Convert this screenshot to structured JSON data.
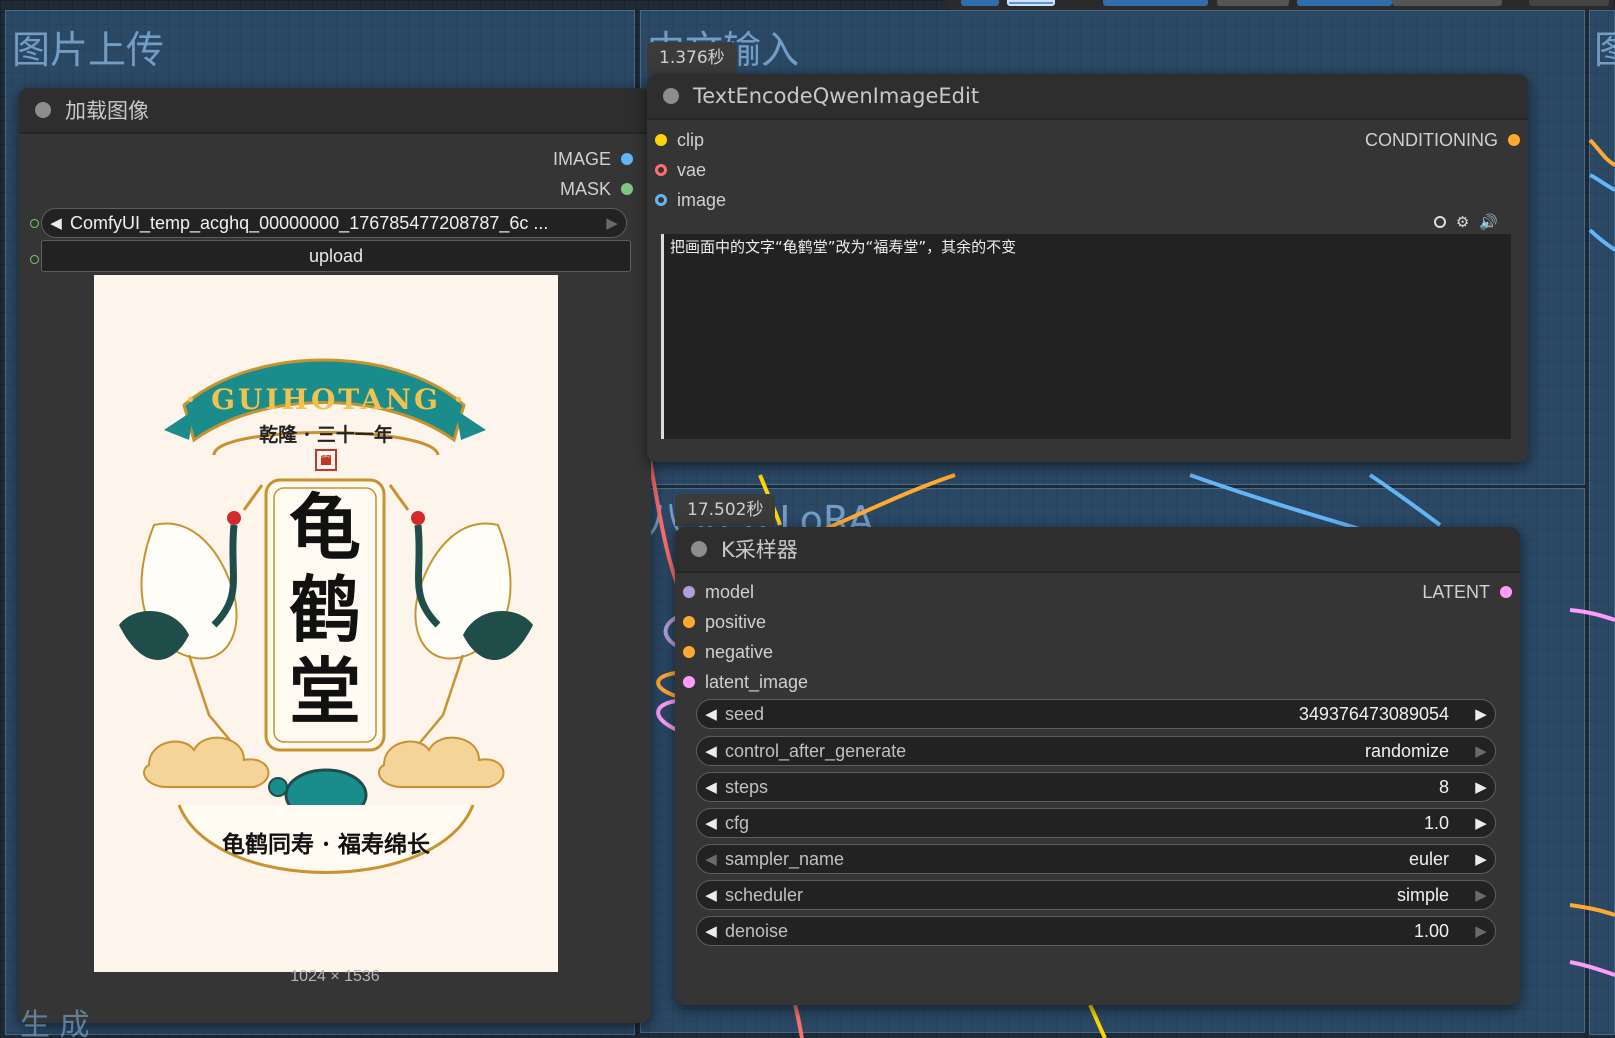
{
  "groups": {
    "upload_title": "图片上传",
    "chinese_input_title": "中文输入",
    "lora_title_partial": "八step LoRA",
    "right_title_partial": "图",
    "bottom_title_partial": "生 成"
  },
  "load_image_node": {
    "title": "加载图像",
    "outputs": [
      "IMAGE",
      "MASK"
    ],
    "filename": "ComfyUI_temp_acghq_00000000_176785477208787_6c  ...",
    "upload_label": "upload",
    "dimensions": "1024 × 1536"
  },
  "poster": {
    "banner_text": "· GUIHOTANG ·",
    "era_text": "乾隆 · 三十一年",
    "main_chars": [
      "龟",
      "鹤",
      "堂"
    ],
    "seal_text": "龟鹤",
    "motto": "龟鹤同寿 · 福寿绵长"
  },
  "text_encode_node": {
    "timing": "1.376秒",
    "title": "TextEncodeQwenImageEdit",
    "inputs": [
      "clip",
      "vae",
      "image"
    ],
    "output": "CONDITIONING",
    "prompt": "把画面中的文字“龟鹤堂”改为“福寿堂”，其余的不变"
  },
  "ksampler_node": {
    "timing": "17.502秒",
    "title": "K采样器",
    "inputs": [
      "model",
      "positive",
      "negative",
      "latent_image"
    ],
    "output": "LATENT",
    "widgets": [
      {
        "label": "seed",
        "value": "349376473089054"
      },
      {
        "label": "control_after_generate",
        "value": "randomize"
      },
      {
        "label": "steps",
        "value": "8"
      },
      {
        "label": "cfg",
        "value": "1.0"
      },
      {
        "label": "sampler_name",
        "value": "euler"
      },
      {
        "label": "scheduler",
        "value": "simple"
      },
      {
        "label": "denoise",
        "value": "1.00"
      }
    ]
  },
  "colors": {
    "image_slot": "#64b5f6",
    "mask_slot": "#81c784",
    "clip_slot": "#ffd500",
    "vae_slot": "#ff6e6e",
    "conditioning_slot": "#ffa931",
    "model_slot": "#b39ddb",
    "latent_slot": "#ff9cf9"
  }
}
